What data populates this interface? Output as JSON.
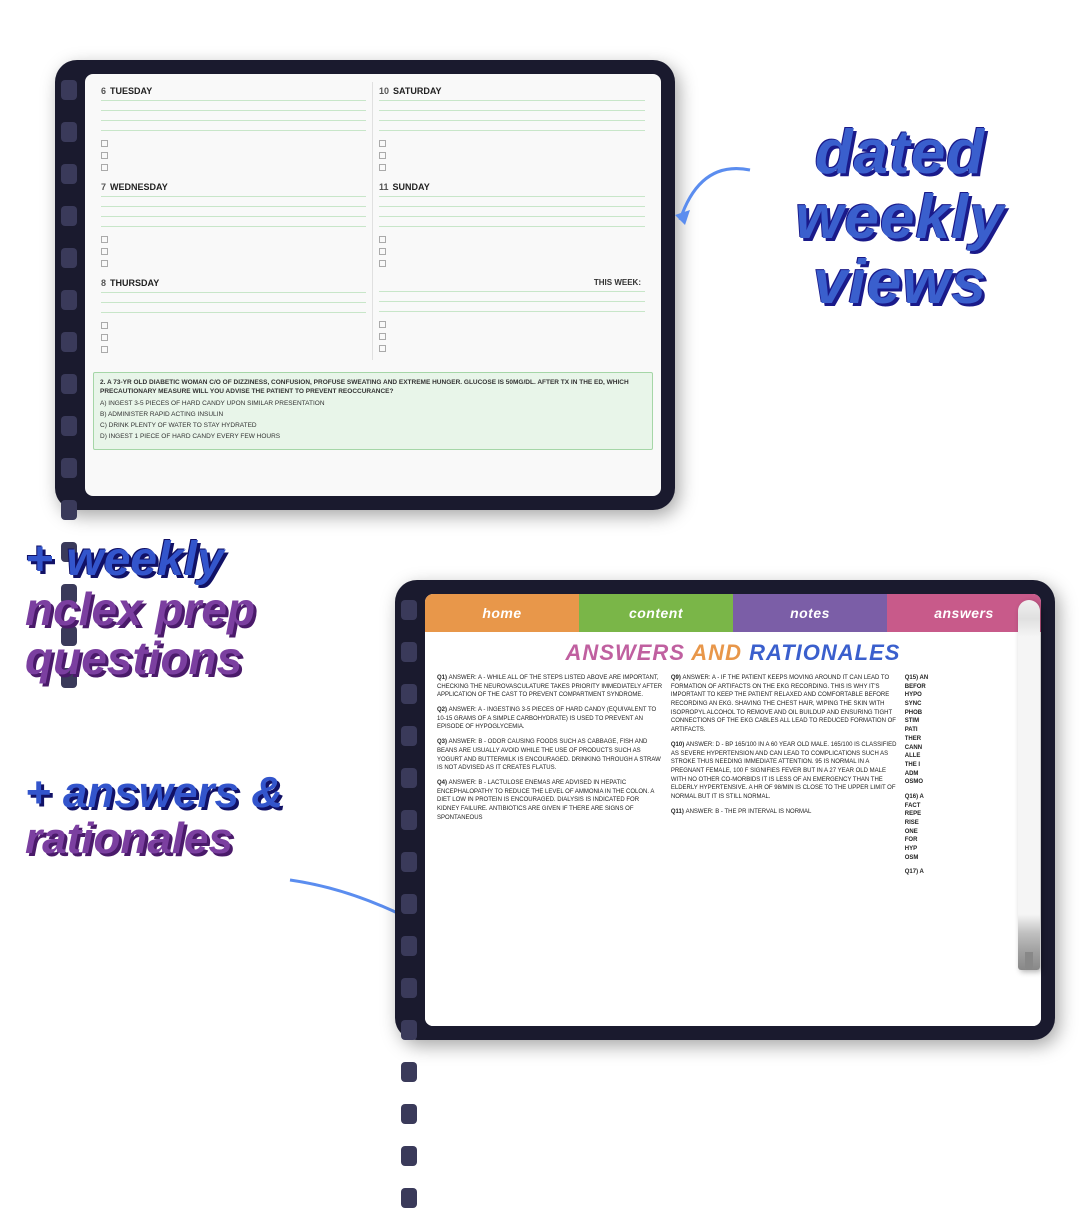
{
  "background": "#ffffff",
  "tablet_top": {
    "label": "iPad top - weekly planner",
    "days": [
      {
        "number": "6",
        "name": "TUESDAY"
      },
      {
        "number": "10",
        "name": "SATURDAY"
      },
      {
        "number": "7",
        "name": "WEDNESDAY"
      },
      {
        "number": "11",
        "name": "SUNDAY"
      },
      {
        "number": "8",
        "name": "THURSDAY"
      }
    ],
    "this_week_label": "THIS WEEK:",
    "question": {
      "text": "2. A 73-YR OLD DIABETIC WOMAN C/O OF DIZZINESS, CONFUSION, PROFUSE SWEATING AND EXTREME HUNGER. GLUCOSE IS 50MG/DL. AFTER TX IN THE ED, WHICH PRECAUTIONARY MEASURE WILL YOU ADVISE THE PATIENT TO PREVENT REOCCURANCE?",
      "options": [
        "A) INGEST 3-5 PIECES OF HARD CANDY UPON SIMILAR PRESENTATION",
        "B) ADMINISTER RAPID ACTING INSULIN",
        "C) DRINK PLENTY OF WATER TO STAY HYDRATED",
        "D) INGEST 1 PIECE OF HARD CANDY EVERY FEW HOURS"
      ]
    }
  },
  "tablet_bottom": {
    "label": "iPad bottom - answers and rationales",
    "tabs": [
      {
        "id": "home",
        "label": "home",
        "color": "#e8974a"
      },
      {
        "id": "content",
        "label": "content",
        "color": "#7ab648"
      },
      {
        "id": "notes",
        "label": "notes",
        "color": "#7b5ea7"
      },
      {
        "id": "answers",
        "label": "answers",
        "color": "#c85a8a"
      }
    ],
    "title": "ANSWERS AND RATIONALES",
    "title_color": "#c060a0",
    "answers": [
      {
        "id": "Q1",
        "text": "ANSWER: A - WHILE ALL OF THE STEPS LISTED ABOVE ARE IMPORTANT, CHECKING THE NEUROVASCULATURE TAKES PRIORITY IMMEDIATELY AFTER APPLICATION OF THE CAST TO PREVENT COMPARTMENT SYNDROME."
      },
      {
        "id": "Q2",
        "text": "ANSWER: A - INGESTING 3-5 PIECES OF HARD CANDY (EQUIVALENT TO 10-15 GRAMS OF A SIMPLE CARBOHYDRATE) IS USED TO PREVENT AN EPISODE OF HYPOGLYCEMIA."
      },
      {
        "id": "Q3",
        "text": "ANSWER: B - ODOR CAUSING FOODS SUCH AS CABBAGE, FISH AND BEANS ARE USUALLY AVOID WHILE THE USE OF PRODUCTS SUCH AS YOGURT AND BUTTERMILK IS ENCOURAGED. DRINKING THROUGH A STRAW IS NOT ADVISED AS IT CREATES FLATUS."
      },
      {
        "id": "Q4",
        "text": "ANSWER: B - LACTULOSE ENEMAS ARE ADVISED IN HEPATIC ENCEPHALOPATHY TO REDUCE THE LEVEL OF AMMONIA IN THE COLON. A DIET LOW IN PROTEIN IS ENCOURAGED. DIALYSIS IS INDICATED FOR KIDNEY FAILURE. ANTIBIOTICS ARE GIVEN IF THERE ARE SIGNS OF SPONTANEOUS"
      },
      {
        "id": "Q9",
        "text": "ANSWER: A - IF THE PATIENT KEEPS MOVING AROUND IT CAN LEAD TO FORMATION OF ARTIFACTS ON THE EKG RECORDING. THIS IS WHY IT'S IMPORTANT TO KEEP THE PATIENT RELAXED AND COMFORTABLE BEFORE RECORDING AN EKG. SHAVING THE CHEST HAIR, WIPING THE SKIN WITH ISOPROPYL ALCOHOL TO REMOVE AND OIL BUILDUP AND ENSURING TIGHT CONNECTIONS OF THE EKG CABLES ALL LEAD TO REDUCED FORMATION OF ARTIFACTS."
      },
      {
        "id": "Q10",
        "text": "ANSWER: D - BP 165/100 IN A 60 YEAR OLD MALE. 165/100 IS CLASSIFIED AS SEVERE HYPERTENSION AND CAN LEAD TO COMPLICATIONS SUCH AS STROKE THUS NEEDING IMMEDIATE ATTENTION. 95 IS NORMAL IN A PREGNANT FEMALE, 100 F SIGNIFIES FEVER BUT IN A 27 YEAR OLD MALE WITH NO OTHER CO-MORBIDS IT IS LESS OF AN EMERGENCY THAN THE ELDERLY HYPERTENSIVE. A HR OF 98/MIN IS CLOSE TO THE UPPER LIMIT OF NORMAL BUT IT IS STILL NORMAL."
      },
      {
        "id": "Q11",
        "text": "ANSWER: B - THE PR INTERVAL IS NORMAL"
      },
      {
        "id": "Q15",
        "text": "ANSWER: A - ..."
      },
      {
        "id": "Q16",
        "text": "ANSWER: A - ..."
      },
      {
        "id": "Q17",
        "text": "ANSWER: A - ..."
      }
    ]
  },
  "labels": {
    "dated_weekly_views": "DaTeD\nWeekly\nViews",
    "plus_weekly": "+ Weekly",
    "nclex_prep": "nclex prep",
    "questions": "Questions",
    "plus_answers": "+ answers &",
    "rationales": "rationales"
  }
}
